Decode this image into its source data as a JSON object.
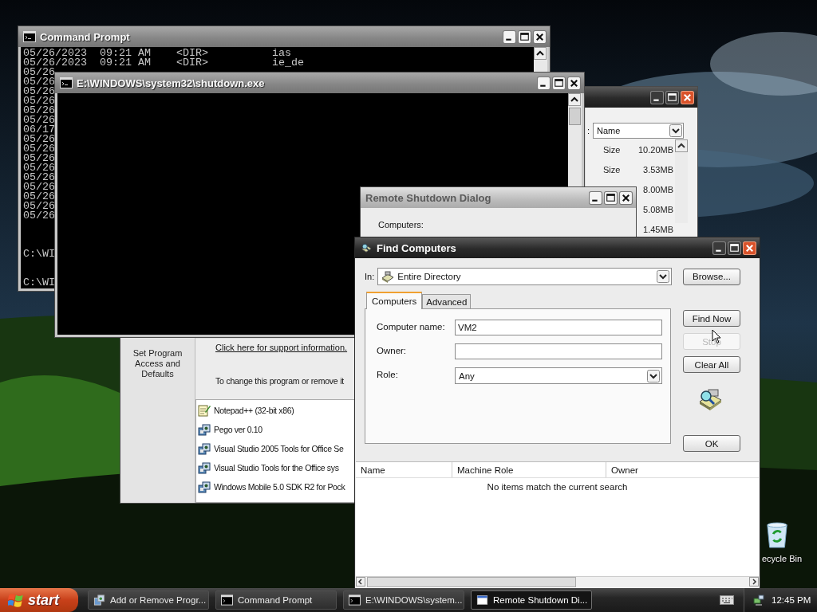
{
  "desktop": {
    "recycle_bin": {
      "label": "ecycle Bin"
    }
  },
  "add_remove_programs": {
    "sort_label": ":",
    "sort_value": "Name",
    "sizes": [
      {
        "label": "Size",
        "value": "10.20MB"
      },
      {
        "label": "Size",
        "value": "3.53MB"
      },
      {
        "value": "8.00MB"
      },
      {
        "value": "5.08MB"
      },
      {
        "value": "1.45MB"
      }
    ],
    "side_task": "Set Program Access and Defaults",
    "support_link": "Click here for support information.",
    "change_hint": "To change this program or remove it",
    "programs": [
      {
        "name": "Notepad++ (32-bit x86)",
        "kind": "notepad"
      },
      {
        "name": "Pego ver 0.10",
        "kind": "installer"
      },
      {
        "name": "Visual Studio 2005 Tools for Office Se",
        "kind": "installer"
      },
      {
        "name": "Visual Studio Tools for the Office sys",
        "kind": "installer"
      },
      {
        "name": "Windows Mobile 5.0 SDK R2 for Pock",
        "kind": "installer"
      }
    ]
  },
  "command_prompt": {
    "title": "Command Prompt",
    "listing": [
      "05/26/2023  09:21 AM    <DIR>          ias",
      "05/26/2023  09:21 AM    <DIR>          ie_de",
      "05/26",
      "05/26",
      "05/26",
      "05/26",
      "05/26",
      "05/26",
      "06/17",
      "05/26",
      "05/26",
      "05/26",
      "05/26",
      "05/26",
      "05/26",
      "05/26",
      "05/26",
      "05/26"
    ],
    "prompts": [
      "C:\\WI",
      "C:\\WI"
    ]
  },
  "shutdown_console": {
    "title": "E:\\WINDOWS\\system32\\shutdown.exe"
  },
  "remote_shutdown": {
    "title": "Remote Shutdown Dialog",
    "computers_label": "Computers:"
  },
  "find_computers": {
    "title": "Find Computers",
    "in_label": "In:",
    "in_value": "Entire Directory",
    "browse": "Browse...",
    "tabs": [
      {
        "label": "Computers",
        "selected": true
      },
      {
        "label": "Advanced",
        "selected": false
      }
    ],
    "fields": [
      {
        "label": "Computer name:",
        "kind": "text",
        "value": "VM2"
      },
      {
        "label": "Owner:",
        "kind": "text"
      },
      {
        "label": "Role:",
        "kind": "select",
        "value": "Any"
      }
    ],
    "buttons": [
      {
        "label": "Find Now",
        "kind": "action",
        "disabled": false
      },
      {
        "label": "Stop",
        "kind": "action",
        "disabled": true
      },
      {
        "label": "Clear All",
        "kind": "action",
        "disabled": false
      },
      {
        "label": "OK",
        "kind": "confirm",
        "disabled": false
      }
    ],
    "columns": [
      "Name",
      "Machine Role",
      "Owner"
    ],
    "empty_message": "No items match the current search"
  },
  "taskbar": {
    "start": "start",
    "tasks": [
      {
        "label": "Add or Remove Progr...",
        "kind": "programs",
        "selected": false
      },
      {
        "label": "Command Prompt",
        "kind": "console",
        "selected": false
      },
      {
        "label": "E:\\WINDOWS\\system...",
        "kind": "console",
        "selected": false
      },
      {
        "label": "Remote Shutdown Di...",
        "kind": "window",
        "selected": true
      }
    ],
    "clock": "12:45 PM"
  }
}
